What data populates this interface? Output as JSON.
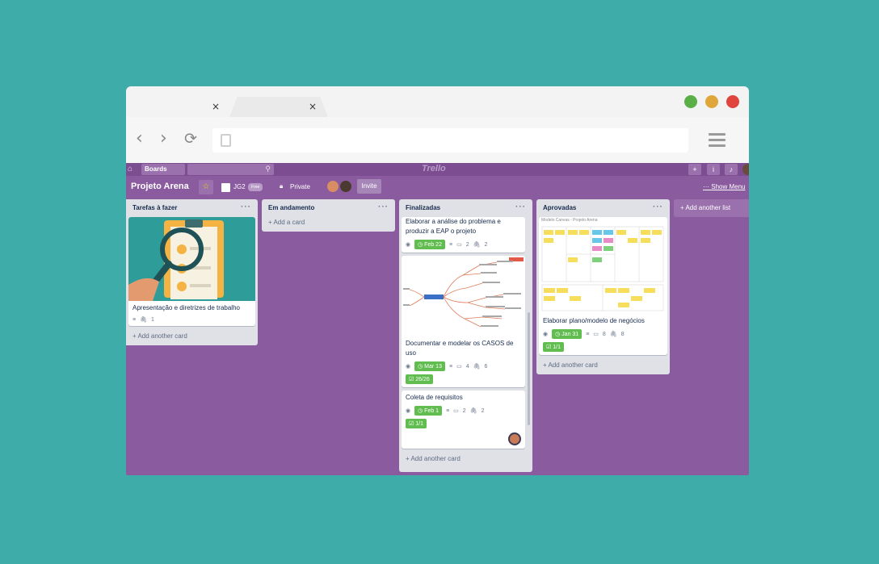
{
  "browser": {
    "tab_close_glyph": "×",
    "controls": {
      "close_color": "#e0443e",
      "minimize_color": "#dfa639",
      "maximize_color": "#5ab046"
    }
  },
  "toolbar": {
    "back": "‹",
    "forward": "›",
    "reload": "⟳"
  },
  "appbar": {
    "boards_label": "Boards",
    "logo": "Trello"
  },
  "board": {
    "title": "Projeto Arena",
    "team_label": "JG2",
    "team_badge": "Free",
    "visibility": "Private",
    "invite_label": "Invite",
    "show_menu": "Show Menu"
  },
  "lists": [
    {
      "title": "Tarefas à fazer",
      "add_label": "+ Add another card",
      "cards": [
        {
          "title": "Apresentação e diretrizes de trabalho",
          "attachments": "1"
        }
      ]
    },
    {
      "title": "Em andamento",
      "add_label": "+ Add a card",
      "cards": []
    },
    {
      "title": "Finalizadas",
      "add_label": "+ Add another card",
      "cards": [
        {
          "title": "Elaborar a análise do problema e produzir a EAP o projeto",
          "due": "Feb 22",
          "comments": "2",
          "attachments": "2"
        },
        {
          "title": "Documentar e modelar os CASOS de uso",
          "due": "Mar 13",
          "comments": "4",
          "attachments": "6",
          "checklist": "26/26"
        },
        {
          "title": "Coleta de requisitos",
          "due": "Feb 1",
          "comments": "2",
          "attachments": "2",
          "checklist": "1/1"
        }
      ]
    },
    {
      "title": "Aprovadas",
      "add_label": "+ Add another card",
      "cards": [
        {
          "title": "Elaborar plano/modelo de negócios",
          "cover_caption": "Modelo Canvas - Projeto Arena",
          "due": "Jan 31",
          "comments": "8",
          "attachments": "8",
          "checklist": "1/1"
        }
      ]
    }
  ],
  "add_list_label": "+ Add another list",
  "icons": {
    "menu": "···",
    "eye": "eye-icon",
    "clock": "clock-icon",
    "description": "description-icon",
    "comment": "comment-icon",
    "attachment": "paperclip-icon",
    "checklist": "checklist-icon"
  }
}
